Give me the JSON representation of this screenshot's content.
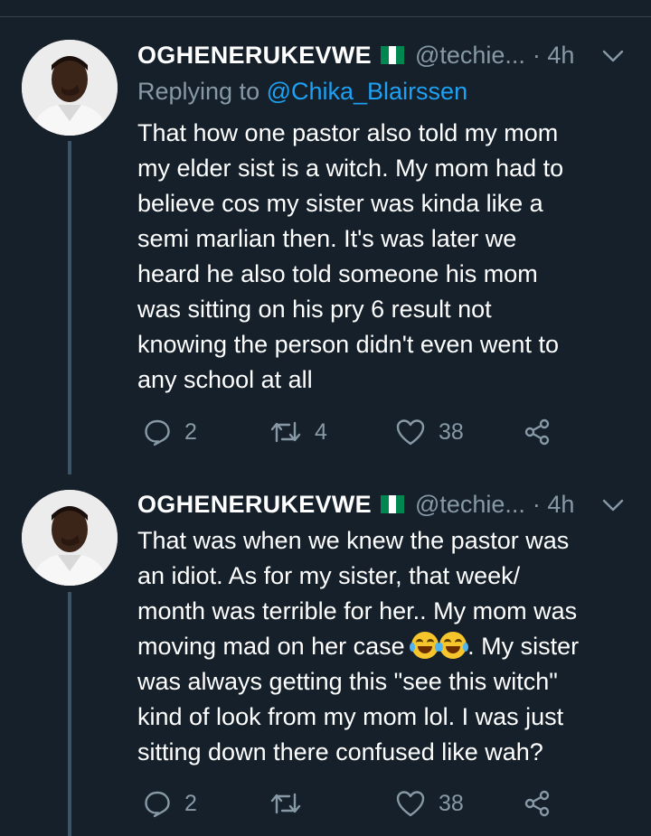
{
  "tweets": [
    {
      "name": "OGHENERUKEVWE",
      "handle": "@techie...",
      "time": "· 4h",
      "flag": [
        "#008751",
        "#ffffff",
        "#008751"
      ],
      "replying_prefix": "Replying to ",
      "replying_to": "@Chika_Blairssen",
      "text_lines": [
        "That how one pastor also told my mom",
        "my elder sist is a witch. My mom had to",
        "believe cos my sister was kinda like a",
        "semi marlian then. It's was later we",
        "heard he also told someone his mom",
        "was sitting on his pry 6 result not",
        "knowing the person didn't even went to",
        "any school at all"
      ],
      "replies": "2",
      "retweets": "4",
      "likes": "38"
    },
    {
      "name": "OGHENERUKEVWE",
      "handle": "@techie...",
      "time": "· 4h",
      "flag": [
        "#008751",
        "#ffffff",
        "#008751"
      ],
      "text_lines": [
        "That was when we knew the pastor was",
        "an idiot. As for my sister, that week/",
        "month was terrible for her.. My mom was"
      ],
      "emoji_line_before": "moving mad on her case ",
      "emoji_name": "face-with-tears-of-joy",
      "emoji_line_after": ". My sister",
      "text_lines_2": [
        "was always getting this \"see this witch\"",
        "kind of look from my mom lol. I was just",
        "sitting down there confused like wah?"
      ],
      "replies": "2",
      "retweets": "",
      "likes": "38"
    }
  ],
  "theme": {
    "background": "#15202b",
    "secondary_text": "#8899a6",
    "link": "#1da1f2",
    "thread_line": "#3d5466"
  },
  "icons": [
    "reply-icon",
    "retweet-icon",
    "like-icon",
    "share-icon",
    "chevron-down-icon"
  ]
}
